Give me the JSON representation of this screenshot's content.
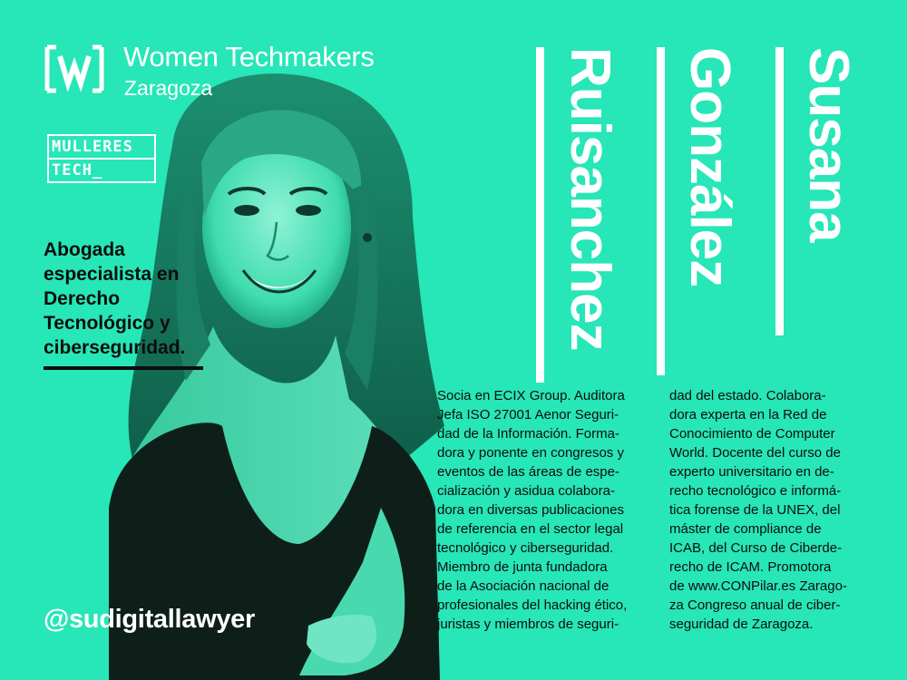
{
  "header": {
    "title": "Women Techmakers",
    "subtitle": "Zaragoza"
  },
  "badge": {
    "line1": "MULLERES",
    "line2": "TECH_"
  },
  "role": "Abogada especialista en Derecho Tecnológico y ciberseguridad.",
  "name": {
    "first": "Susana",
    "middle": "González",
    "last": "Ruisanchez"
  },
  "bio": {
    "column1": "Socia en ECIX Group. Auditora\nJefa ISO 27001 Aenor Seguri-\ndad de la Información. Forma-\ndora y ponente en congresos y\neventos de las áreas de espe-\ncialización y asidua colabora-\ndora en diversas publicaciones\nde referencia en el sector legal\ntecnológico y ciberseguridad.\nMiembro de junta fundadora\nde la Asociación nacional de\nprofesionales del hacking ético,\njuristas y miembros de seguri-",
    "column2": "dad del estado. Colabora-\ndora experta en la Red de\nConocimiento de Computer\nWorld. Docente del curso de\nexperto universitario en de-\nrecho tecnológico e informá-\ntica forense de la UNEX, del\nmáster de compliance de\nICAB, del Curso de Ciberde-\nrecho de ICAM. Promotora\nde www.CONPilar.es Zarago-\nza Congreso anual de ciber-\nseguridad de Zaragoza."
  },
  "handle": "@sudigitallawyer",
  "icons": {
    "logo": "women-techmakers-logo-icon",
    "portrait": "speaker-portrait"
  },
  "colors": {
    "background": "#27e6b7",
    "text_dark": "#0d0d0d",
    "text_light": "#ffffff"
  }
}
